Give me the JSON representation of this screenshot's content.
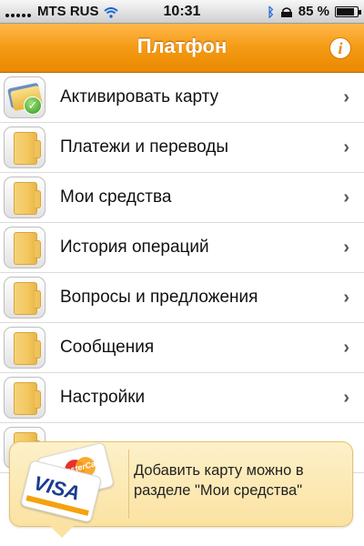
{
  "status_bar": {
    "carrier": "MTS RUS",
    "time": "10:31",
    "battery": "85 %",
    "battery_level": 0.85
  },
  "nav": {
    "title": "Платфон",
    "info_label": "i"
  },
  "menu": {
    "items": [
      {
        "label": "Активировать карту",
        "icon": "card-check-icon"
      },
      {
        "label": "Платежи и переводы",
        "icon": "folder-icon"
      },
      {
        "label": "Мои средства",
        "icon": "folder-icon"
      },
      {
        "label": "История операций",
        "icon": "folder-icon"
      },
      {
        "label": "Вопросы и предложения",
        "icon": "folder-icon"
      },
      {
        "label": "Сообщения",
        "icon": "folder-icon"
      },
      {
        "label": "Настройки",
        "icon": "folder-icon"
      }
    ],
    "chevron": "›"
  },
  "banner": {
    "text": "Добавить карту можно в разделе \"Мои средства\"",
    "mastercard": "MasterCard",
    "visa": "VISA"
  },
  "colors": {
    "accent": "#f49a14",
    "nav_text": "#ffffff"
  }
}
